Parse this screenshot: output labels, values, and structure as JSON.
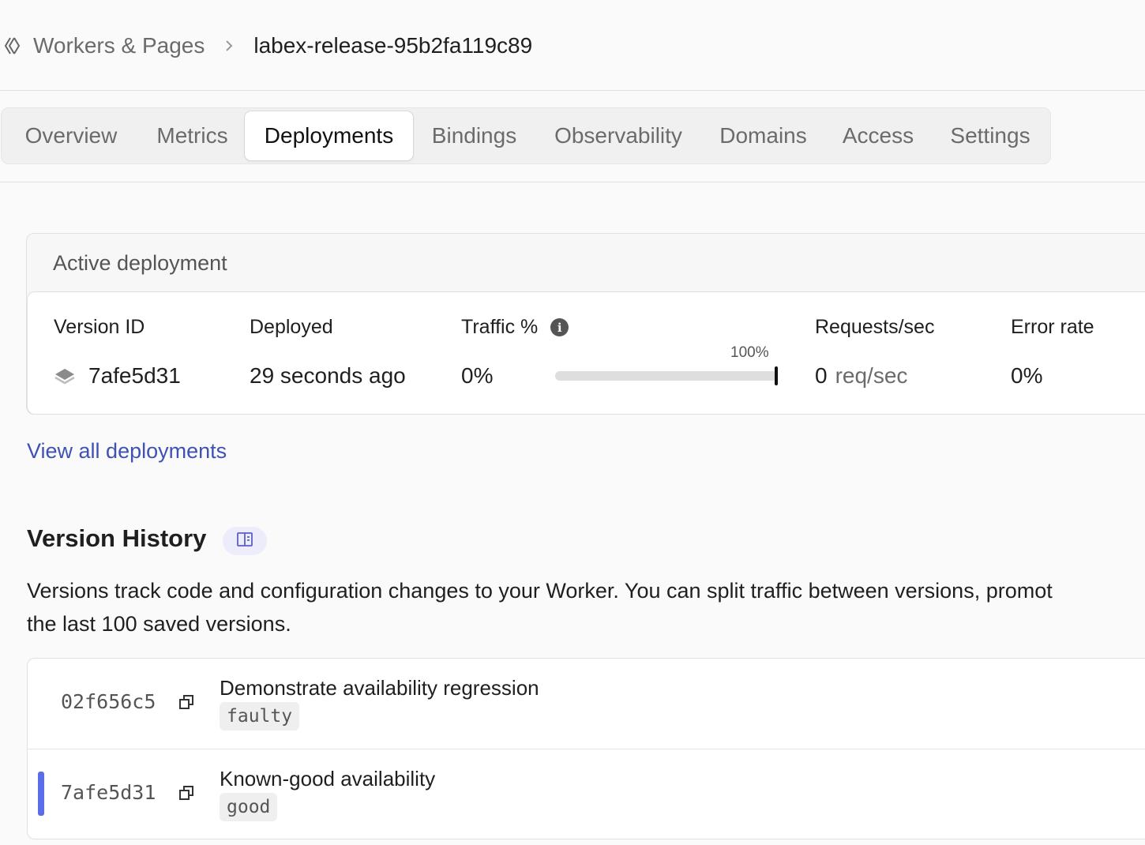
{
  "breadcrumb": {
    "parent": "Workers & Pages",
    "current": "labex-release-95b2fa119c89"
  },
  "tabs": [
    {
      "label": "Overview"
    },
    {
      "label": "Metrics"
    },
    {
      "label": "Deployments",
      "active": true
    },
    {
      "label": "Bindings"
    },
    {
      "label": "Observability"
    },
    {
      "label": "Domains"
    },
    {
      "label": "Access"
    },
    {
      "label": "Settings"
    }
  ],
  "active_deployment": {
    "title": "Active deployment",
    "headers": {
      "version_id": "Version ID",
      "deployed": "Deployed",
      "traffic": "Traffic %",
      "requests": "Requests/sec",
      "error_rate": "Error rate"
    },
    "version_id": "7afe5d31",
    "deployed": "29 seconds ago",
    "traffic_value": "0%",
    "traffic_bar_label": "100%",
    "requests_value": "0",
    "requests_unit": "req/sec",
    "error_rate": "0%"
  },
  "view_all_link": "View all deployments",
  "version_history": {
    "title": "Version History",
    "description_line1": "Versions track code and configuration changes to your Worker. You can split traffic between versions, promot",
    "description_line2": "the last 100 saved versions.",
    "versions": [
      {
        "id": "02f656c5",
        "message": "Demonstrate availability regression",
        "tag": "faulty",
        "active": false
      },
      {
        "id": "7afe5d31",
        "message": "Known-good availability",
        "tag": "good",
        "active": true
      }
    ]
  },
  "colors": {
    "link": "#3f51b5",
    "active_indicator": "#5b6de8"
  }
}
